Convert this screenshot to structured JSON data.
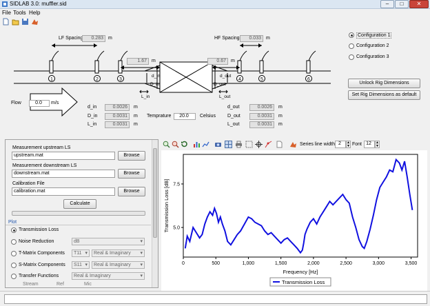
{
  "window": {
    "title": "SIDLAB 3.0: muffler.sid",
    "minimize": "–",
    "maximize": "□",
    "close": "✕"
  },
  "menu": [
    "File",
    "Tools",
    "Help"
  ],
  "rig": {
    "lf_spacing_label": "LF Spacing",
    "lf_spacing_value": "0.283",
    "lf_spacing_unit": "m",
    "hf_spacing_label": "HF Spacing",
    "hf_spacing_value": "0.033",
    "hf_spacing_unit": "m",
    "mic_left_value": "1.67",
    "mic_left_unit": "m",
    "mic_right_value": "0.67",
    "mic_right_unit": "m",
    "mic_numbers": [
      "1",
      "2",
      "3",
      "4",
      "5",
      "6"
    ],
    "d_in": "d_in",
    "D_in": "D_in",
    "L_in": "L_in",
    "d_out": "d_out",
    "D_out": "D_out",
    "L_out": "L_out",
    "flow_label": "Flow",
    "flow_value": "0.0",
    "flow_unit": "m/s"
  },
  "dims_in": [
    {
      "label": "d_in",
      "value": "0.0026",
      "unit": "m"
    },
    {
      "label": "D_in",
      "value": "0.0031",
      "unit": "m"
    },
    {
      "label": "L_in",
      "value": "0.0031",
      "unit": "m"
    }
  ],
  "dims_out": [
    {
      "label": "d_out",
      "value": "0.0026",
      "unit": "m"
    },
    {
      "label": "D_out",
      "value": "0.0031",
      "unit": "m"
    },
    {
      "label": "L_out",
      "value": "0.0031",
      "unit": "m"
    }
  ],
  "temperature": {
    "label": "Temprature",
    "value": "20.0",
    "unit": "Celsius"
  },
  "configurations": [
    {
      "label": "Configuration 1",
      "selected": true
    },
    {
      "label": "Configuration 2",
      "selected": false
    },
    {
      "label": "Configuration 3",
      "selected": false
    }
  ],
  "buttons": {
    "unlock": "Unlock Rig Dimensions",
    "set_default": "Set Rig Dimensions as default"
  },
  "files": {
    "upstream_label": "Measurement upstream LS",
    "upstream_value": "upstream.mat",
    "downstream_label": "Measurement downstream LS",
    "downstream_value": "downstream.mat",
    "calibration_label": "Calibration File",
    "calibration_value": "calibration.mat",
    "browse": "Browse",
    "calculate": "Calculate"
  },
  "plot_options": {
    "section": "Plot",
    "items": [
      {
        "label": "Transmission Loss",
        "selected": true
      },
      {
        "label": "Noise Reduction",
        "selected": false,
        "combo1": "dB"
      },
      {
        "label": "T-Matrix Components",
        "selected": false,
        "combo1": "T11",
        "combo2": "Real & Imaginary"
      },
      {
        "label": "S-Matrix Components",
        "selected": false,
        "combo1": "S11",
        "combo2": "Real & Imaginary"
      },
      {
        "label": "Transfer Functions",
        "selected": false,
        "combo1": "Real & Imaginary"
      }
    ],
    "columns": [
      "Stream",
      "Ref",
      "Mic"
    ]
  },
  "plot_toolbar": {
    "series_line_width_label": "Series line width",
    "series_line_width": "2",
    "font_label": "Font",
    "font": "12"
  },
  "colors": {
    "series": "#1010e0"
  },
  "chart_data": {
    "type": "line",
    "xlabel": "Frequency [Hz]",
    "ylabel": "Transmission Loss [dB]",
    "xlim": [
      0,
      3600
    ],
    "ylim": [
      3.3,
      9.2
    ],
    "xticks": [
      0,
      500,
      1000,
      1500,
      2000,
      2500,
      3000,
      3500
    ],
    "xtick_labels": [
      "0",
      "500",
      "1,000",
      "1,500",
      "2,000",
      "2,500",
      "3,000",
      "3,500"
    ],
    "yticks": [
      5.0,
      7.5
    ],
    "ytick_labels": [
      "5.0",
      "7.5"
    ],
    "legend": "bottom-center",
    "series": [
      {
        "name": "Transmission Loss",
        "x": [
          30,
          60,
          100,
          150,
          200,
          250,
          290,
          330,
          370,
          410,
          450,
          480,
          510,
          540,
          570,
          600,
          640,
          680,
          730,
          780,
          830,
          880,
          940,
          1000,
          1050,
          1100,
          1150,
          1200,
          1250,
          1300,
          1350,
          1400,
          1450,
          1500,
          1550,
          1600,
          1650,
          1700,
          1750,
          1800,
          1830,
          1850,
          1870,
          1900,
          1950,
          2000,
          2050,
          2100,
          2150,
          2200,
          2250,
          2300,
          2350,
          2400,
          2450,
          2500,
          2550,
          2600,
          2650,
          2700,
          2750,
          2780,
          2820,
          2870,
          2920,
          2970,
          3020,
          3070,
          3120,
          3170,
          3220,
          3270,
          3320,
          3360,
          3400,
          3440,
          3480,
          3520
        ],
        "y": [
          3.8,
          4.5,
          4.2,
          5.0,
          4.7,
          4.4,
          4.6,
          5.2,
          5.6,
          5.9,
          5.7,
          6.1,
          5.8,
          5.3,
          5.6,
          5.2,
          4.8,
          4.2,
          4.0,
          4.3,
          4.6,
          4.8,
          5.2,
          5.6,
          5.5,
          5.3,
          5.2,
          5.1,
          4.8,
          4.6,
          4.7,
          4.5,
          4.3,
          4.1,
          4.3,
          4.4,
          4.2,
          4.0,
          3.8,
          3.55,
          3.7,
          4.1,
          4.6,
          4.9,
          5.3,
          5.5,
          5.2,
          5.6,
          5.9,
          6.2,
          6.5,
          6.3,
          6.5,
          6.7,
          6.9,
          6.6,
          6.4,
          5.6,
          5.0,
          4.3,
          3.9,
          3.8,
          4.2,
          4.9,
          5.7,
          6.6,
          7.3,
          7.6,
          7.9,
          8.3,
          8.2,
          8.9,
          8.7,
          8.3,
          8.8,
          7.9,
          6.9,
          6.0
        ]
      }
    ]
  }
}
